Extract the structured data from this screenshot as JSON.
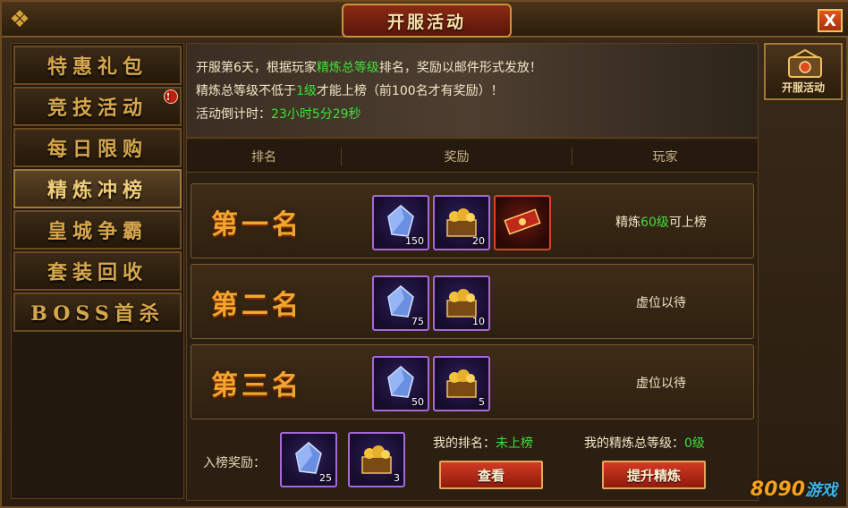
{
  "window": {
    "title": "开服活动",
    "close_glyph": "X"
  },
  "menu": {
    "items": [
      {
        "label": "特惠礼包",
        "active": false,
        "badge": ""
      },
      {
        "label": "竞技活动",
        "active": false,
        "badge": "!"
      },
      {
        "label": "每日限购",
        "active": false,
        "badge": ""
      },
      {
        "label": "精炼冲榜",
        "active": true,
        "badge": ""
      },
      {
        "label": "皇城争霸",
        "active": false,
        "badge": ""
      },
      {
        "label": "套装回收",
        "active": false,
        "badge": ""
      },
      {
        "label": "BOSS首杀",
        "active": false,
        "badge": ""
      }
    ]
  },
  "side_tab": {
    "label": "开服活动",
    "icon": "event-icon"
  },
  "banner": {
    "line1_pre": "开服第6天，根据玩家",
    "line1_hl": "精炼总等级",
    "line1_post": "排名，奖励以邮件形式发放！",
    "line2_pre": "精炼总等级不低于",
    "line2_hl": "1级",
    "line2_post": "才能上榜（前100名才有奖励）！",
    "line3_pre": "活动倒计时：",
    "line3_hl": "23小时5分29秒"
  },
  "table": {
    "headers": [
      "排名",
      "奖励",
      "玩家"
    ],
    "rows": [
      {
        "rank": "第一名",
        "rewards": [
          {
            "icon": "crystal-icon",
            "count": "150"
          },
          {
            "icon": "gold-chest-icon",
            "count": "20"
          },
          {
            "icon": "title-badge-icon",
            "count": ""
          }
        ],
        "player_pre": "精炼",
        "player_hl": "60级",
        "player_post": "可上榜"
      },
      {
        "rank": "第二名",
        "rewards": [
          {
            "icon": "crystal-icon",
            "count": "75"
          },
          {
            "icon": "gold-chest-icon",
            "count": "10"
          }
        ],
        "player_pre": "虚位以待",
        "player_hl": "",
        "player_post": ""
      },
      {
        "rank": "第三名",
        "rewards": [
          {
            "icon": "crystal-icon",
            "count": "50"
          },
          {
            "icon": "gold-chest-icon",
            "count": "5"
          }
        ],
        "player_pre": "虚位以待",
        "player_hl": "",
        "player_post": ""
      }
    ]
  },
  "footer": {
    "label": "入榜奖励：",
    "rewards": [
      {
        "icon": "crystal-icon",
        "count": "25"
      },
      {
        "icon": "gold-chest-icon",
        "count": "3"
      }
    ],
    "my_rank_label": "我的排名：",
    "my_rank_value": "未上榜",
    "my_level_label": "我的精炼总等级：",
    "my_level_value": "0级",
    "view_button": "查看",
    "upgrade_button": "提升精炼"
  },
  "watermark": {
    "num": "8090",
    "text": "游戏"
  },
  "colors": {
    "highlight_green": "#3fe03a",
    "rank_gold": "#f2a52e",
    "button_red": "#d23a24"
  }
}
